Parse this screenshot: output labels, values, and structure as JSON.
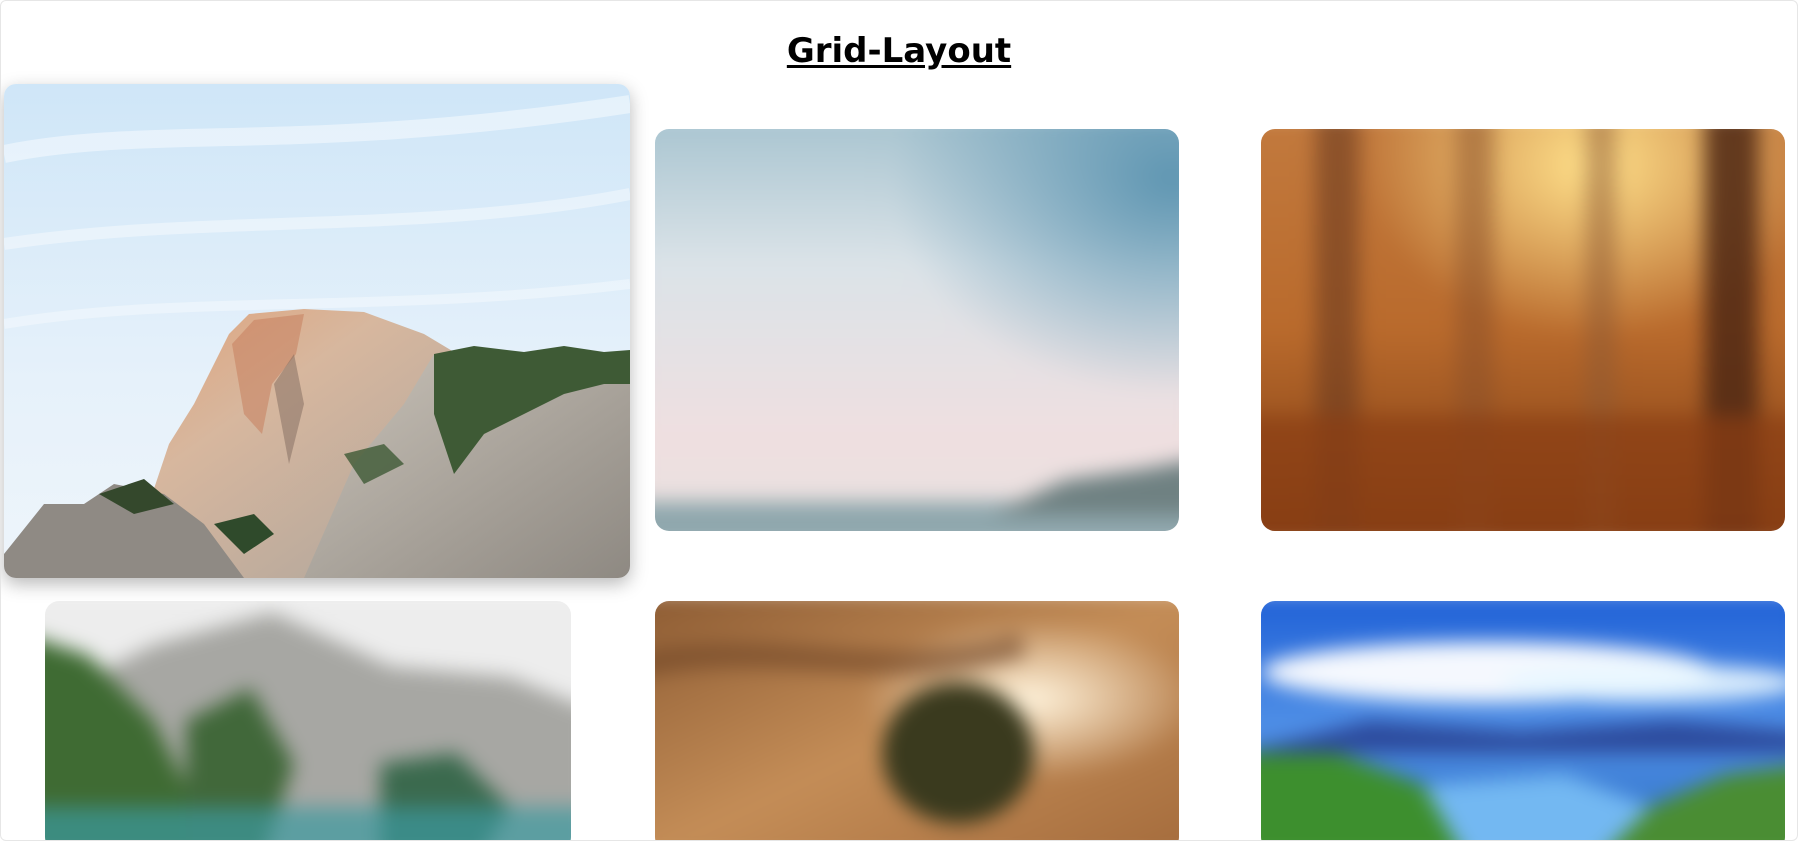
{
  "page": {
    "title": "Grid-Layout"
  },
  "gallery": {
    "items": [
      {
        "name": "granite-dome-mountain",
        "state": "focused"
      },
      {
        "name": "pastel-sky-lake",
        "state": "blurred"
      },
      {
        "name": "autumn-forest-sunlight",
        "state": "blurred"
      },
      {
        "name": "mountain-lake-pines",
        "state": "blurred"
      },
      {
        "name": "golden-desert-tree",
        "state": "blurred"
      },
      {
        "name": "blue-sky-river-valley",
        "state": "blurred"
      }
    ]
  }
}
